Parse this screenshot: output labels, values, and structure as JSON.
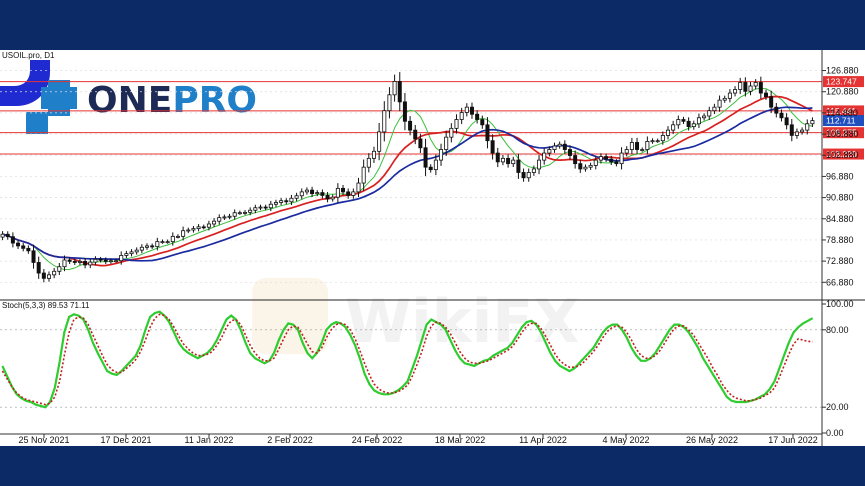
{
  "logo": {
    "part1": "ONE",
    "part2": "PRO",
    "color1": "#1c2a55",
    "color2": "#1f7fc9"
  },
  "watermark": {
    "text": "WikiFX"
  },
  "chart_data": [
    {
      "type": "candlestick",
      "title": "USOIL.pro, D1",
      "y_ticks": [
        126.88,
        120.88,
        114.88,
        108.88,
        102.88,
        96.88,
        90.88,
        84.88,
        78.88,
        72.88,
        66.88
      ],
      "ylim": [
        63.0,
        131.0
      ],
      "x_ticks": [
        "25 Nov 2021",
        "17 Dec 2021",
        "11 Jan 2022",
        "2 Feb 2022",
        "24 Feb 2022",
        "18 Mar 2022",
        "11 Apr 2022",
        "4 May 2022",
        "26 May 2022",
        "17 Jun 2022"
      ],
      "horizontal_levels": [
        {
          "value": 123.747,
          "label": "123.747",
          "color": "#e53333"
        },
        {
          "value": 115.441,
          "label": "115.441",
          "color": "#e53333"
        },
        {
          "value": 109.275,
          "label": "109.275",
          "color": "#e53333"
        },
        {
          "value": 103.22,
          "label": "103.220",
          "color": "#e53333"
        }
      ],
      "current_price": {
        "value": 112.711,
        "label": "112.711",
        "color": "#1f4fbf"
      },
      "close": [
        80.5,
        79.8,
        78.0,
        77.2,
        76.5,
        75.8,
        72.5,
        69.5,
        68.0,
        69.0,
        70.0,
        71.3,
        73.2,
        72.8,
        72.5,
        72.8,
        71.8,
        72.6,
        73.4,
        73.2,
        72.8,
        73.0,
        73.0,
        74.5,
        75.0,
        75.5,
        76.0,
        76.8,
        77.2,
        77.0,
        78.4,
        78.4,
        78.4,
        79.9,
        79.9,
        81.5,
        81.7,
        82.1,
        82.6,
        82.5,
        83.4,
        84.2,
        85.2,
        85.4,
        85.6,
        86.6,
        86.6,
        86.7,
        87.3,
        88.0,
        88.2,
        88.0,
        89.0,
        89.5,
        90.0,
        89.7,
        90.7,
        91.4,
        92.5,
        93.0,
        92.0,
        92.3,
        91.5,
        90.5,
        91.0,
        93.5,
        92.5,
        91.5,
        92.5,
        95.0,
        99.5,
        102.0,
        104.0,
        109.5,
        115.5,
        120.0,
        123.8,
        118.0,
        112.5,
        110.0,
        107.5,
        105.0,
        99.5,
        98.8,
        101.5,
        104.5,
        108.0,
        110.5,
        113.0,
        115.0,
        116.5,
        114.5,
        113.0,
        111.5,
        107.0,
        103.5,
        101.0,
        102.0,
        100.5,
        101.5,
        98.0,
        96.5,
        98.0,
        99.0,
        101.5,
        103.5,
        104.5,
        105.5,
        106.0,
        104.5,
        102.8,
        100.5,
        99.0,
        99.5,
        100.0,
        101.5,
        102.5,
        101.8,
        101.0,
        100.5,
        103.5,
        104.5,
        106.5,
        104.5,
        104.5,
        106.8,
        107.0,
        107.0,
        108.5,
        110.0,
        111.5,
        113.0,
        112.5,
        111.0,
        111.8,
        113.5,
        114.0,
        115.5,
        116.5,
        118.5,
        119.0,
        120.5,
        121.5,
        123.5,
        121.0,
        122.5,
        123.5,
        120.5,
        119.5,
        116.5,
        114.8,
        113.5,
        111.5,
        108.5,
        109.5,
        110.0,
        111.8,
        112.7
      ],
      "indicators": [
        {
          "name": "fast_ma",
          "color": "#3cbf3c"
        },
        {
          "name": "mid_ma",
          "color": "#d92020"
        },
        {
          "name": "slow_ma",
          "color": "#1a2aa0"
        }
      ]
    },
    {
      "type": "line",
      "title": "Stoch(5,3,3) 89.53 71.11",
      "y_ticks": [
        100.0,
        80.0,
        20.0,
        0.0
      ],
      "ylim": [
        0,
        100
      ],
      "series": [
        {
          "name": "",
          "color": "#2ecc2e",
          "values": [
            52,
            44,
            36,
            30,
            27,
            25,
            24,
            22,
            21,
            20,
            24,
            35,
            55,
            78,
            90,
            92,
            91,
            88,
            80,
            70,
            62,
            55,
            48,
            46,
            45,
            48,
            52,
            56,
            60,
            68,
            80,
            90,
            93,
            94,
            91,
            86,
            78,
            70,
            65,
            62,
            60,
            58,
            60,
            62,
            66,
            72,
            80,
            88,
            91,
            88,
            80,
            70,
            62,
            58,
            56,
            54,
            56,
            62,
            72,
            80,
            85,
            84,
            80,
            70,
            62,
            58,
            62,
            70,
            80,
            84,
            86,
            85,
            82,
            76,
            68,
            58,
            46,
            38,
            33,
            31,
            30,
            30,
            31,
            33,
            36,
            40,
            50,
            60,
            72,
            84,
            88,
            86,
            84,
            80,
            72,
            64,
            58,
            54,
            53,
            52,
            54,
            56,
            57,
            60,
            62,
            64,
            66,
            70,
            76,
            82,
            86,
            87,
            84,
            78,
            70,
            62,
            56,
            52,
            50,
            48,
            50,
            54,
            58,
            62,
            66,
            72,
            78,
            82,
            84,
            84,
            80,
            74,
            66,
            60,
            56,
            56,
            58,
            62,
            68,
            74,
            80,
            84,
            84,
            82,
            78,
            72,
            66,
            58,
            52,
            46,
            40,
            34,
            28,
            25,
            24,
            24,
            24,
            25,
            26,
            28,
            30,
            34,
            40,
            50,
            60,
            70,
            78,
            82,
            85,
            87,
            89
          ]
        },
        {
          "name": "",
          "color": "#c02020",
          "values": [
            48,
            42,
            36,
            31,
            28,
            26,
            25,
            24,
            23,
            22,
            23,
            28,
            40,
            60,
            78,
            88,
            90,
            89,
            84,
            76,
            68,
            60,
            53,
            49,
            47,
            47,
            50,
            53,
            57,
            63,
            72,
            82,
            89,
            92,
            91,
            88,
            82,
            75,
            69,
            65,
            62,
            60,
            60,
            61,
            63,
            68,
            74,
            82,
            87,
            88,
            84,
            76,
            68,
            62,
            58,
            56,
            56,
            58,
            65,
            73,
            80,
            83,
            82,
            76,
            69,
            63,
            62,
            66,
            74,
            80,
            84,
            85,
            84,
            80,
            73,
            64,
            54,
            45,
            38,
            34,
            32,
            31,
            31,
            32,
            34,
            37,
            44,
            53,
            63,
            75,
            83,
            86,
            85,
            82,
            77,
            70,
            63,
            58,
            55,
            54,
            54,
            55,
            56,
            58,
            60,
            62,
            64,
            67,
            72,
            78,
            83,
            85,
            85,
            81,
            75,
            68,
            61,
            56,
            53,
            51,
            51,
            52,
            55,
            59,
            63,
            68,
            74,
            79,
            82,
            83,
            82,
            78,
            72,
            65,
            60,
            58,
            58,
            60,
            64,
            70,
            76,
            81,
            83,
            83,
            80,
            76,
            70,
            64,
            58,
            51,
            45,
            38,
            33,
            29,
            27,
            26,
            25,
            25,
            26,
            27,
            29,
            31,
            35,
            43,
            52,
            61,
            69,
            73,
            72,
            71,
            71
          ]
        }
      ]
    }
  ]
}
